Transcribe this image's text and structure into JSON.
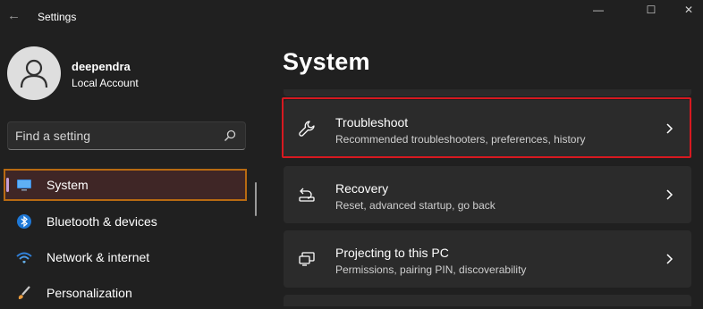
{
  "window": {
    "title": "Settings",
    "controls": {
      "minimize": "—",
      "maximize": "☐",
      "close": "✕"
    }
  },
  "account": {
    "name": "deependra",
    "type": "Local Account"
  },
  "search": {
    "placeholder": "Find a setting",
    "value": ""
  },
  "sidebar": {
    "items": [
      {
        "label": "System",
        "icon": "monitor-icon",
        "active": true
      },
      {
        "label": "Bluetooth & devices",
        "icon": "bluetooth-icon",
        "active": false
      },
      {
        "label": "Network & internet",
        "icon": "wifi-icon",
        "active": false
      },
      {
        "label": "Personalization",
        "icon": "brush-icon",
        "active": false
      }
    ]
  },
  "main": {
    "title": "System",
    "cards": [
      {
        "title": "Troubleshoot",
        "description": "Recommended troubleshooters, preferences, history",
        "icon": "wrench-icon",
        "highlighted": true
      },
      {
        "title": "Recovery",
        "description": "Reset, advanced startup, go back",
        "icon": "recovery-icon",
        "highlighted": false
      },
      {
        "title": "Projecting to this PC",
        "description": "Permissions, pairing PIN, discoverability",
        "icon": "projecting-icon",
        "highlighted": false
      }
    ]
  },
  "colors": {
    "background": "#202020",
    "card": "#2b2b2b",
    "accent_indicator": "#c59fd6",
    "highlight_red": "#d71920",
    "highlight_orange": "#b86a12"
  }
}
